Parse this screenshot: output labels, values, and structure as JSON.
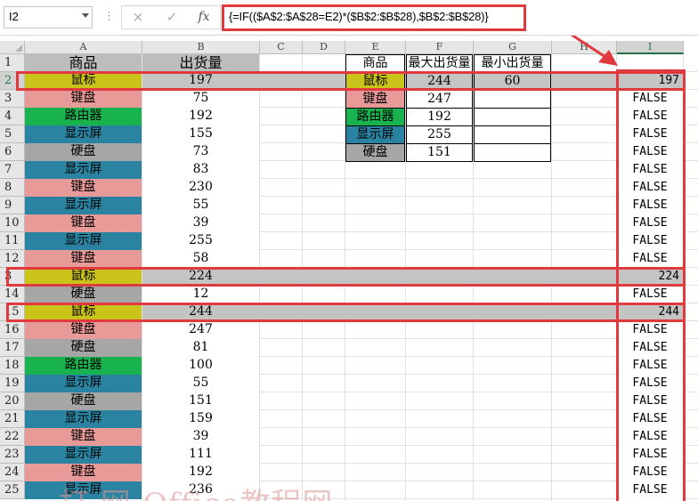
{
  "formula_bar": {
    "name_box": "I2",
    "dots": "⋮",
    "cancel_icon": "×",
    "enter_icon": "✓",
    "fx_label": "fx",
    "formula": "{=IF(($A$2:$A$28=E2)*($B$2:$B$28),$B$2:$B$28)}"
  },
  "columns": [
    "A",
    "B",
    "C",
    "D",
    "E",
    "F",
    "G",
    "H",
    "I"
  ],
  "rows": [
    "1",
    "2",
    "3",
    "4",
    "5",
    "6",
    "7",
    "8",
    "9",
    "10",
    "11",
    "12",
    "3",
    "14",
    "15",
    "16",
    "17",
    "18",
    "19",
    "20",
    "21",
    "22",
    "23",
    "24",
    "25"
  ],
  "headers": {
    "a1": "商品",
    "b1": "出货量",
    "e1": "商品",
    "f1": "最大出货量",
    "g1": "最小出货量"
  },
  "data": [
    {
      "product": "鼠标",
      "qty": "197",
      "i": "197"
    },
    {
      "product": "键盘",
      "qty": "75",
      "i": "FALSE"
    },
    {
      "product": "路由器",
      "qty": "192",
      "i": "FALSE"
    },
    {
      "product": "显示屏",
      "qty": "155",
      "i": "FALSE"
    },
    {
      "product": "硬盘",
      "qty": "73",
      "i": "FALSE"
    },
    {
      "product": "显示屏",
      "qty": "83",
      "i": "FALSE"
    },
    {
      "product": "键盘",
      "qty": "230",
      "i": "FALSE"
    },
    {
      "product": "显示屏",
      "qty": "55",
      "i": "FALSE"
    },
    {
      "product": "键盘",
      "qty": "39",
      "i": "FALSE"
    },
    {
      "product": "显示屏",
      "qty": "255",
      "i": "FALSE"
    },
    {
      "product": "键盘",
      "qty": "58",
      "i": "FALSE"
    },
    {
      "product": "鼠标",
      "qty": "224",
      "i": "224"
    },
    {
      "product": "硬盘",
      "qty": "12",
      "i": "FALSE"
    },
    {
      "product": "鼠标",
      "qty": "244",
      "i": "244"
    },
    {
      "product": "键盘",
      "qty": "247",
      "i": "FALSE"
    },
    {
      "product": "硬盘",
      "qty": "81",
      "i": "FALSE"
    },
    {
      "product": "路由器",
      "qty": "100",
      "i": "FALSE"
    },
    {
      "product": "显示屏",
      "qty": "55",
      "i": "FALSE"
    },
    {
      "product": "硬盘",
      "qty": "151",
      "i": "FALSE"
    },
    {
      "product": "显示屏",
      "qty": "159",
      "i": "FALSE"
    },
    {
      "product": "键盘",
      "qty": "39",
      "i": "FALSE"
    },
    {
      "product": "显示屏",
      "qty": "111",
      "i": "FALSE"
    },
    {
      "product": "键盘",
      "qty": "192",
      "i": "FALSE"
    },
    {
      "product": "显示屏",
      "qty": "236",
      "i": "FALSE"
    }
  ],
  "summary": [
    {
      "product": "鼠标",
      "max": "244",
      "min": "60"
    },
    {
      "product": "键盘",
      "max": "247",
      "min": ""
    },
    {
      "product": "路由器",
      "max": "192",
      "min": ""
    },
    {
      "product": "显示屏",
      "max": "255",
      "min": ""
    },
    {
      "product": "硬盘",
      "max": "151",
      "min": ""
    }
  ],
  "product_colors": {
    "鼠标": "#c9c31a",
    "键盘": "#e79a98",
    "路由器": "#18b34f",
    "显示屏": "#2a84a1",
    "硬盘": "#a6a6a6"
  },
  "colors": {
    "highlight_row": "#c4c4c4",
    "annotation_red": "#e03a3e",
    "header_gray": "#e6e6e6"
  },
  "watermark": "打 网-Office教程网"
}
